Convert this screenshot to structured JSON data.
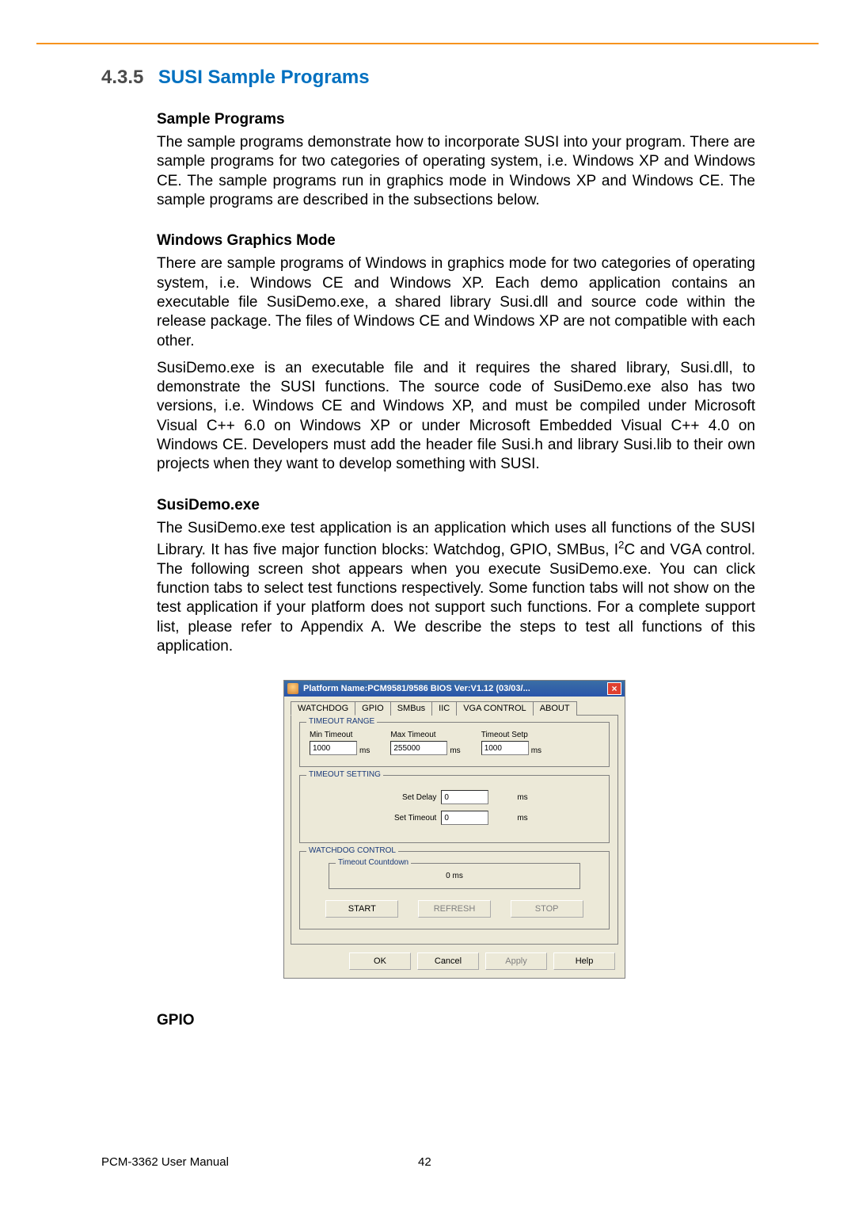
{
  "section": {
    "number": "4.3.5",
    "title": "SUSI Sample Programs"
  },
  "h1": "Sample Programs",
  "p1": "The sample programs demonstrate how to incorporate SUSI into your program. There are sample programs for two categories of operating system, i.e. Windows XP and Windows CE. The sample programs run in graphics mode in Windows XP and Windows CE. The sample programs are described in the subsections below.",
  "h2": "Windows Graphics Mode",
  "p2": "There are sample programs of Windows in graphics mode for two categories of operating system, i.e. Windows CE and Windows XP. Each demo application contains an executable file SusiDemo.exe, a shared library Susi.dll and source code within the release package. The files of Windows CE and Windows XP are not compatible with each other.",
  "p3": "SusiDemo.exe is an executable file and it requires the shared library, Susi.dll, to demonstrate the SUSI functions. The source code of SusiDemo.exe also has two versions, i.e. Windows CE and Windows XP, and must be compiled under Microsoft Visual C++ 6.0 on Windows XP or under Microsoft Embedded Visual C++ 4.0 on Windows CE. Developers must add the header file Susi.h and library Susi.lib to their own projects when they want to develop something with SUSI.",
  "h3": "SusiDemo.exe",
  "p4a": "The SusiDemo.exe test application is an application which uses all functions of the SUSI Library. It has five major function blocks: Watchdog, GPIO, SMBus, I",
  "p4b": "C and VGA control. The following screen shot appears when you execute SusiDemo.exe. You can click function tabs to select test functions respectively. Some function tabs will not show on the test application if your platform does not support such functions. For a complete support list, please refer to Appendix A. We describe the steps to test all functions of this application.",
  "sup": "2",
  "dialog": {
    "title": "Platform Name:PCM9581/9586   BIOS Ver:V1.12 (03/03/...",
    "tabs": [
      "WATCHDOG",
      "GPIO",
      "SMBus",
      "IIC",
      "VGA CONTROL",
      "ABOUT"
    ],
    "grp1": {
      "label": "TIMEOUT RANGE",
      "min_label": "Min Timeout",
      "min_val": "1000",
      "max_label": "Max Timeout",
      "max_val": "255000",
      "step_label": "Timeout Setp",
      "step_val": "1000",
      "unit": "ms"
    },
    "grp2": {
      "label": "TIMEOUT SETTING",
      "delay_label": "Set Delay",
      "delay_val": "0",
      "timeout_label": "Set Timeout",
      "timeout_val": "0",
      "unit": "ms"
    },
    "grp3": {
      "label": "WATCHDOG CONTROL",
      "inner_label": "Timeout Countdown",
      "countdown": "0  ms",
      "start": "START",
      "refresh": "REFRESH",
      "stop": "STOP"
    },
    "buttons": {
      "ok": "OK",
      "cancel": "Cancel",
      "apply": "Apply",
      "help": "Help"
    }
  },
  "gpio_heading": "GPIO",
  "footer": {
    "manual": "PCM-3362 User Manual",
    "page": "42"
  }
}
